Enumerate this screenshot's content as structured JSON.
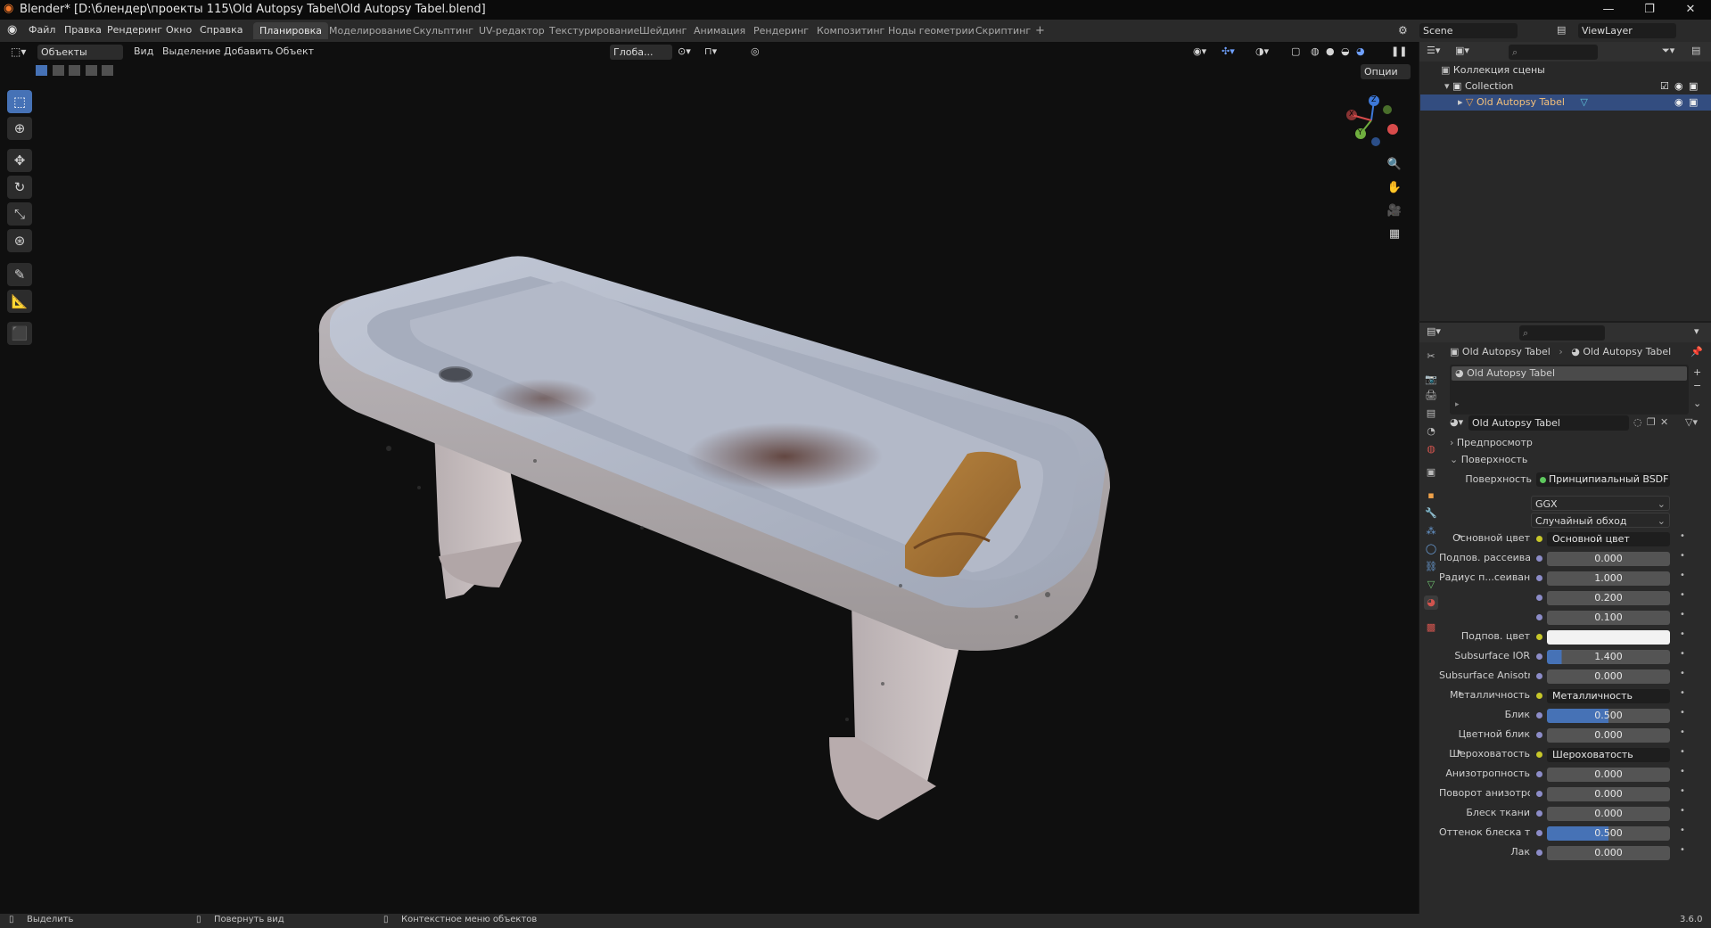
{
  "window": {
    "title": "Blender* [D:\\блендер\\проекты 115\\Old Autopsy Tabel\\Old Autopsy Tabel.blend]",
    "minimize": "—",
    "maximize": "❐",
    "close": "✕"
  },
  "menu": [
    "Файл",
    "Правка",
    "Рендеринг",
    "Окно",
    "Справка"
  ],
  "workspaces": {
    "tabs": [
      "Планировка",
      "Моделирование",
      "Скульптинг",
      "UV-редактор",
      "Текстурирование",
      "Шейдинг",
      "Анимация",
      "Рендеринг",
      "Композитинг",
      "Ноды геометрии",
      "Скриптинг"
    ],
    "active": "Планировка",
    "add": "+"
  },
  "scene": {
    "name": "Scene",
    "view_layer": "ViewLayer"
  },
  "viewport_header": {
    "mode": "Объекты",
    "menus": [
      "Вид",
      "Выделение",
      "Добавить",
      "Объект"
    ],
    "transform_orientation": "Глоба...",
    "options": "Опции"
  },
  "toolbar_icons": [
    "select-box-icon",
    "cursor-icon",
    "move-icon",
    "rotate-icon",
    "scale-icon",
    "transform-icon",
    "annotate-icon",
    "measure-icon",
    "add-cube-icon"
  ],
  "gizmo": {
    "x": "X",
    "y": "Y",
    "z": "Z"
  },
  "outliner": {
    "root": "Коллекция сцены",
    "collection": "Collection",
    "object": "Old Autopsy Tabel"
  },
  "properties": {
    "breadcrumb_object": "Old Autopsy Tabel",
    "breadcrumb_material": "Old Autopsy Tabel",
    "material_slot": "Old Autopsy Tabel",
    "material_name": "Old Autopsy Tabel",
    "preview_section": "Предпросмотр",
    "surface_section": "Поверхность",
    "surface_label": "Поверхность",
    "surface_shader": "Принципиальный BSDF",
    "distribution": "GGX",
    "subsurface_method": "Случайный обход",
    "rows": [
      {
        "label": "Основной цвет",
        "value": "Основной цвет",
        "type": "link"
      },
      {
        "label": "Подпов. рассеива...",
        "value": "0.000",
        "type": "num"
      },
      {
        "label": "Радиус п...сеивания",
        "value": "1.000",
        "type": "num"
      },
      {
        "label": "",
        "value": "0.200",
        "type": "num"
      },
      {
        "label": "",
        "value": "0.100",
        "type": "num"
      },
      {
        "label": "Подпов. цвет",
        "value": "",
        "type": "color"
      },
      {
        "label": "Subsurface IOR",
        "value": "1.400",
        "type": "num",
        "fill": 0.12
      },
      {
        "label": "Subsurface Anisotr...",
        "value": "0.000",
        "type": "num"
      },
      {
        "label": "Металличность",
        "value": "Металличность",
        "type": "link"
      },
      {
        "label": "Блик",
        "value": "0.500",
        "type": "num",
        "fill": 0.5
      },
      {
        "label": "Цветной блик",
        "value": "0.000",
        "type": "num"
      },
      {
        "label": "Шероховатость",
        "value": "Шероховатость",
        "type": "link"
      },
      {
        "label": "Анизотропность",
        "value": "0.000",
        "type": "num"
      },
      {
        "label": "Поворот анизотро...",
        "value": "0.000",
        "type": "num"
      },
      {
        "label": "Блеск ткани",
        "value": "0.000",
        "type": "num"
      },
      {
        "label": "Оттенок блеска тк...",
        "value": "0.500",
        "type": "num",
        "fill": 0.5
      },
      {
        "label": "Лак",
        "value": "0.000",
        "type": "num"
      }
    ]
  },
  "statusbar": {
    "select": "Выделить",
    "rotate": "Повернуть вид",
    "context": "Контекстное меню объектов",
    "version": "3.6.0"
  },
  "colors": {
    "accent": "#4672b6",
    "selected_row": "#334d80",
    "viewport_bg": "#0f0f0f"
  }
}
